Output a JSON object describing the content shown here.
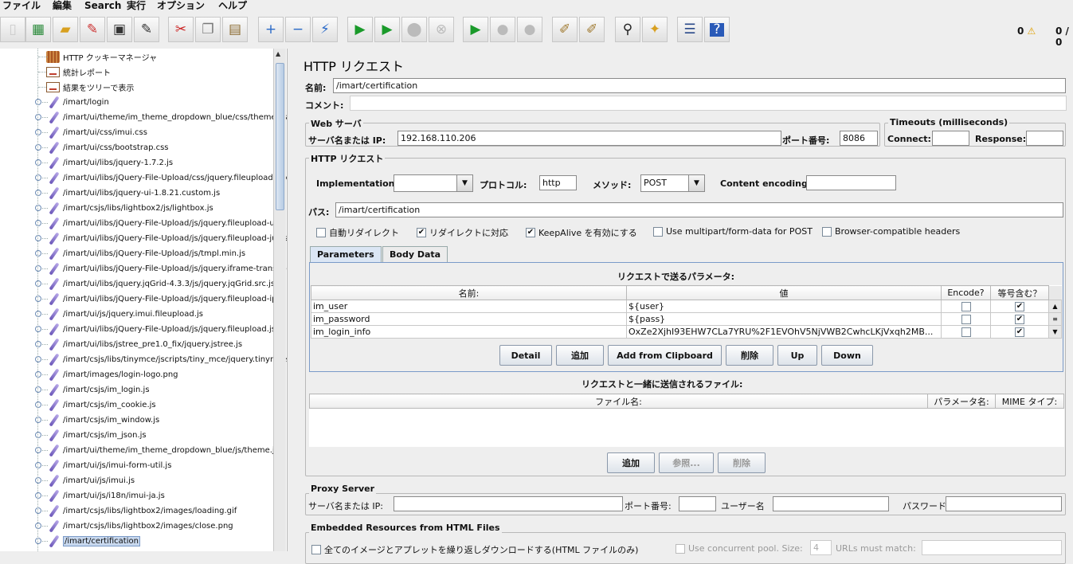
{
  "menu": [
    "ファイル",
    "編集",
    "Search",
    "実行",
    "オプション",
    "ヘルプ"
  ],
  "toolbar": {
    "icons": [
      "new-icon",
      "templates-icon",
      "open-icon",
      "close-icon",
      "save-icon",
      "save-as-icon",
      "cut-icon",
      "copy-icon",
      "paste-icon",
      "expand-icon",
      "collapse-icon",
      "toggle-icon",
      "start-icon",
      "start-no-pause-icon",
      "stop-icon",
      "shutdown-icon",
      "remote-start-icon",
      "remote-stop-icon",
      "remote-shutdown-icon",
      "clear-icon",
      "clear-all-icon",
      "search-icon",
      "reset-search-icon",
      "function-helper-icon",
      "help-icon"
    ],
    "warnings": "0",
    "threads": "0 / 0"
  },
  "tree": {
    "items": [
      {
        "label": "HTTP クッキーマネージャ",
        "icon": "cookie-manager-icon"
      },
      {
        "label": "統計レポート",
        "icon": "listener-icon"
      },
      {
        "label": "結果をツリーで表示",
        "icon": "listener-icon"
      },
      {
        "label": "/imart/login",
        "icon": "sampler-icon"
      },
      {
        "label": "/imart/ui/theme/im_theme_dropdown_blue/css/theme.css",
        "icon": "sampler-icon"
      },
      {
        "label": "/imart/ui/css/imui.css",
        "icon": "sampler-icon"
      },
      {
        "label": "/imart/ui/css/bootstrap.css",
        "icon": "sampler-icon"
      },
      {
        "label": "/imart/ui/libs/jquery-1.7.2.js",
        "icon": "sampler-icon"
      },
      {
        "label": "/imart/ui/libs/jQuery-File-Upload/css/jquery.fileupload-ui.css",
        "icon": "sampler-icon"
      },
      {
        "label": "/imart/ui/libs/jquery-ui-1.8.21.custom.js",
        "icon": "sampler-icon"
      },
      {
        "label": "/imart/csjs/libs/lightbox2/js/lightbox.js",
        "icon": "sampler-icon"
      },
      {
        "label": "/imart/ui/libs/jQuery-File-Upload/js/jquery.fileupload-ui.js",
        "icon": "sampler-icon"
      },
      {
        "label": "/imart/ui/libs/jQuery-File-Upload/js/jquery.fileupload-jui.js",
        "icon": "sampler-icon"
      },
      {
        "label": "/imart/ui/libs/jQuery-File-Upload/js/tmpl.min.js",
        "icon": "sampler-icon"
      },
      {
        "label": "/imart/ui/libs/jQuery-File-Upload/js/jquery.iframe-transport.js",
        "icon": "sampler-icon"
      },
      {
        "label": "/imart/ui/libs/jquery.jqGrid-4.3.3/js/jquery.jqGrid.src.js",
        "icon": "sampler-icon"
      },
      {
        "label": "/imart/ui/libs/jQuery-File-Upload/js/jquery.fileupload-ip.js",
        "icon": "sampler-icon"
      },
      {
        "label": "/imart/ui/js/jquery.imui.fileupload.js",
        "icon": "sampler-icon"
      },
      {
        "label": "/imart/ui/libs/jQuery-File-Upload/js/jquery.fileupload.js",
        "icon": "sampler-icon"
      },
      {
        "label": "/imart/ui/libs/jstree_pre1.0_fix/jquery.jstree.js",
        "icon": "sampler-icon"
      },
      {
        "label": "/imart/csjs/libs/tinymce/jscripts/tiny_mce/jquery.tinymce.js",
        "icon": "sampler-icon"
      },
      {
        "label": "/imart/images/login-logo.png",
        "icon": "sampler-icon"
      },
      {
        "label": "/imart/csjs/im_login.js",
        "icon": "sampler-icon"
      },
      {
        "label": "/imart/csjs/im_cookie.js",
        "icon": "sampler-icon"
      },
      {
        "label": "/imart/csjs/im_window.js",
        "icon": "sampler-icon"
      },
      {
        "label": "/imart/csjs/im_json.js",
        "icon": "sampler-icon"
      },
      {
        "label": "/imart/ui/theme/im_theme_dropdown_blue/js/theme.js",
        "icon": "sampler-icon"
      },
      {
        "label": "/imart/ui/js/imui-form-util.js",
        "icon": "sampler-icon"
      },
      {
        "label": "/imart/ui/js/imui.js",
        "icon": "sampler-icon"
      },
      {
        "label": "/imart/ui/js/i18n/imui-ja.js",
        "icon": "sampler-icon"
      },
      {
        "label": "/imart/csjs/libs/lightbox2/images/loading.gif",
        "icon": "sampler-icon"
      },
      {
        "label": "/imart/csjs/libs/lightbox2/images/close.png",
        "icon": "sampler-icon"
      },
      {
        "label": "/imart/certification",
        "icon": "sampler-icon",
        "selected": true
      }
    ]
  },
  "panel": {
    "title": "HTTP リクエスト",
    "name_label": "名前:",
    "name_value": "/imart/certification",
    "comment_label": "コメント:",
    "comment_value": "",
    "web_server": {
      "title": "Web サーバ",
      "server_label": "サーバ名または IP:",
      "server_value": "192.168.110.206",
      "port_label": "ポート番号:",
      "port_value": "8086"
    },
    "timeouts": {
      "title": "Timeouts (milliseconds)",
      "connect_label": "Connect:",
      "connect_value": "",
      "response_label": "Response:",
      "response_value": ""
    },
    "http_request": {
      "title": "HTTP リクエスト",
      "implementation_label": "Implementation:",
      "implementation_value": "",
      "protocol_label": "プロトコル:",
      "protocol_value": "http",
      "method_label": "メソッド:",
      "method_value": "POST",
      "encoding_label": "Content encoding:",
      "encoding_value": "",
      "path_label": "パス:",
      "path_value": "/imart/certification",
      "checkboxes": [
        {
          "label": "自動リダイレクト",
          "checked": false
        },
        {
          "label": "リダイレクトに対応",
          "checked": true
        },
        {
          "label": "KeepAlive を有効にする",
          "checked": true
        },
        {
          "label": "Use multipart/form-data for POST",
          "checked": false
        },
        {
          "label": "Browser-compatible headers",
          "checked": false
        }
      ]
    },
    "tabs": [
      "Parameters",
      "Body Data"
    ],
    "params": {
      "title": "リクエストで送るパラメータ:",
      "columns": [
        "名前:",
        "値",
        "Encode?",
        "等号含む？"
      ],
      "rows": [
        {
          "name": "im_user",
          "value": "${user}",
          "encode": false,
          "equals": true
        },
        {
          "name": "im_password",
          "value": "${pass}",
          "encode": false,
          "equals": true
        },
        {
          "name": "im_login_info",
          "value": "OxZe2XjhI93EHW7CLa7YRU%2F1EVOhV5NjVWB2CwhcLKjVxqh2MB...",
          "encode": false,
          "equals": true
        }
      ],
      "buttons": [
        "Detail",
        "追加",
        "Add from Clipboard",
        "削除",
        "Up",
        "Down"
      ]
    },
    "files": {
      "title": "リクエストと一緒に送信されるファイル:",
      "columns": [
        "ファイル名:",
        "パラメータ名:",
        "MIME タイプ:"
      ],
      "buttons": [
        "追加",
        "参照...",
        "削除"
      ]
    },
    "proxy": {
      "title": "Proxy Server",
      "server_label": "サーバ名または IP:",
      "port_label": "ポート番号:",
      "user_label": "ユーザー名",
      "password_label": "パスワード"
    },
    "embedded": {
      "title": "Embedded Resources from HTML Files",
      "retrieve_label": "全てのイメージとアプレットを繰り返しダウンロードする(HTML ファイルのみ)",
      "concurrent_label": "Use concurrent pool. Size:",
      "pool_size": "4",
      "urls_label": "URLs must match:"
    }
  }
}
